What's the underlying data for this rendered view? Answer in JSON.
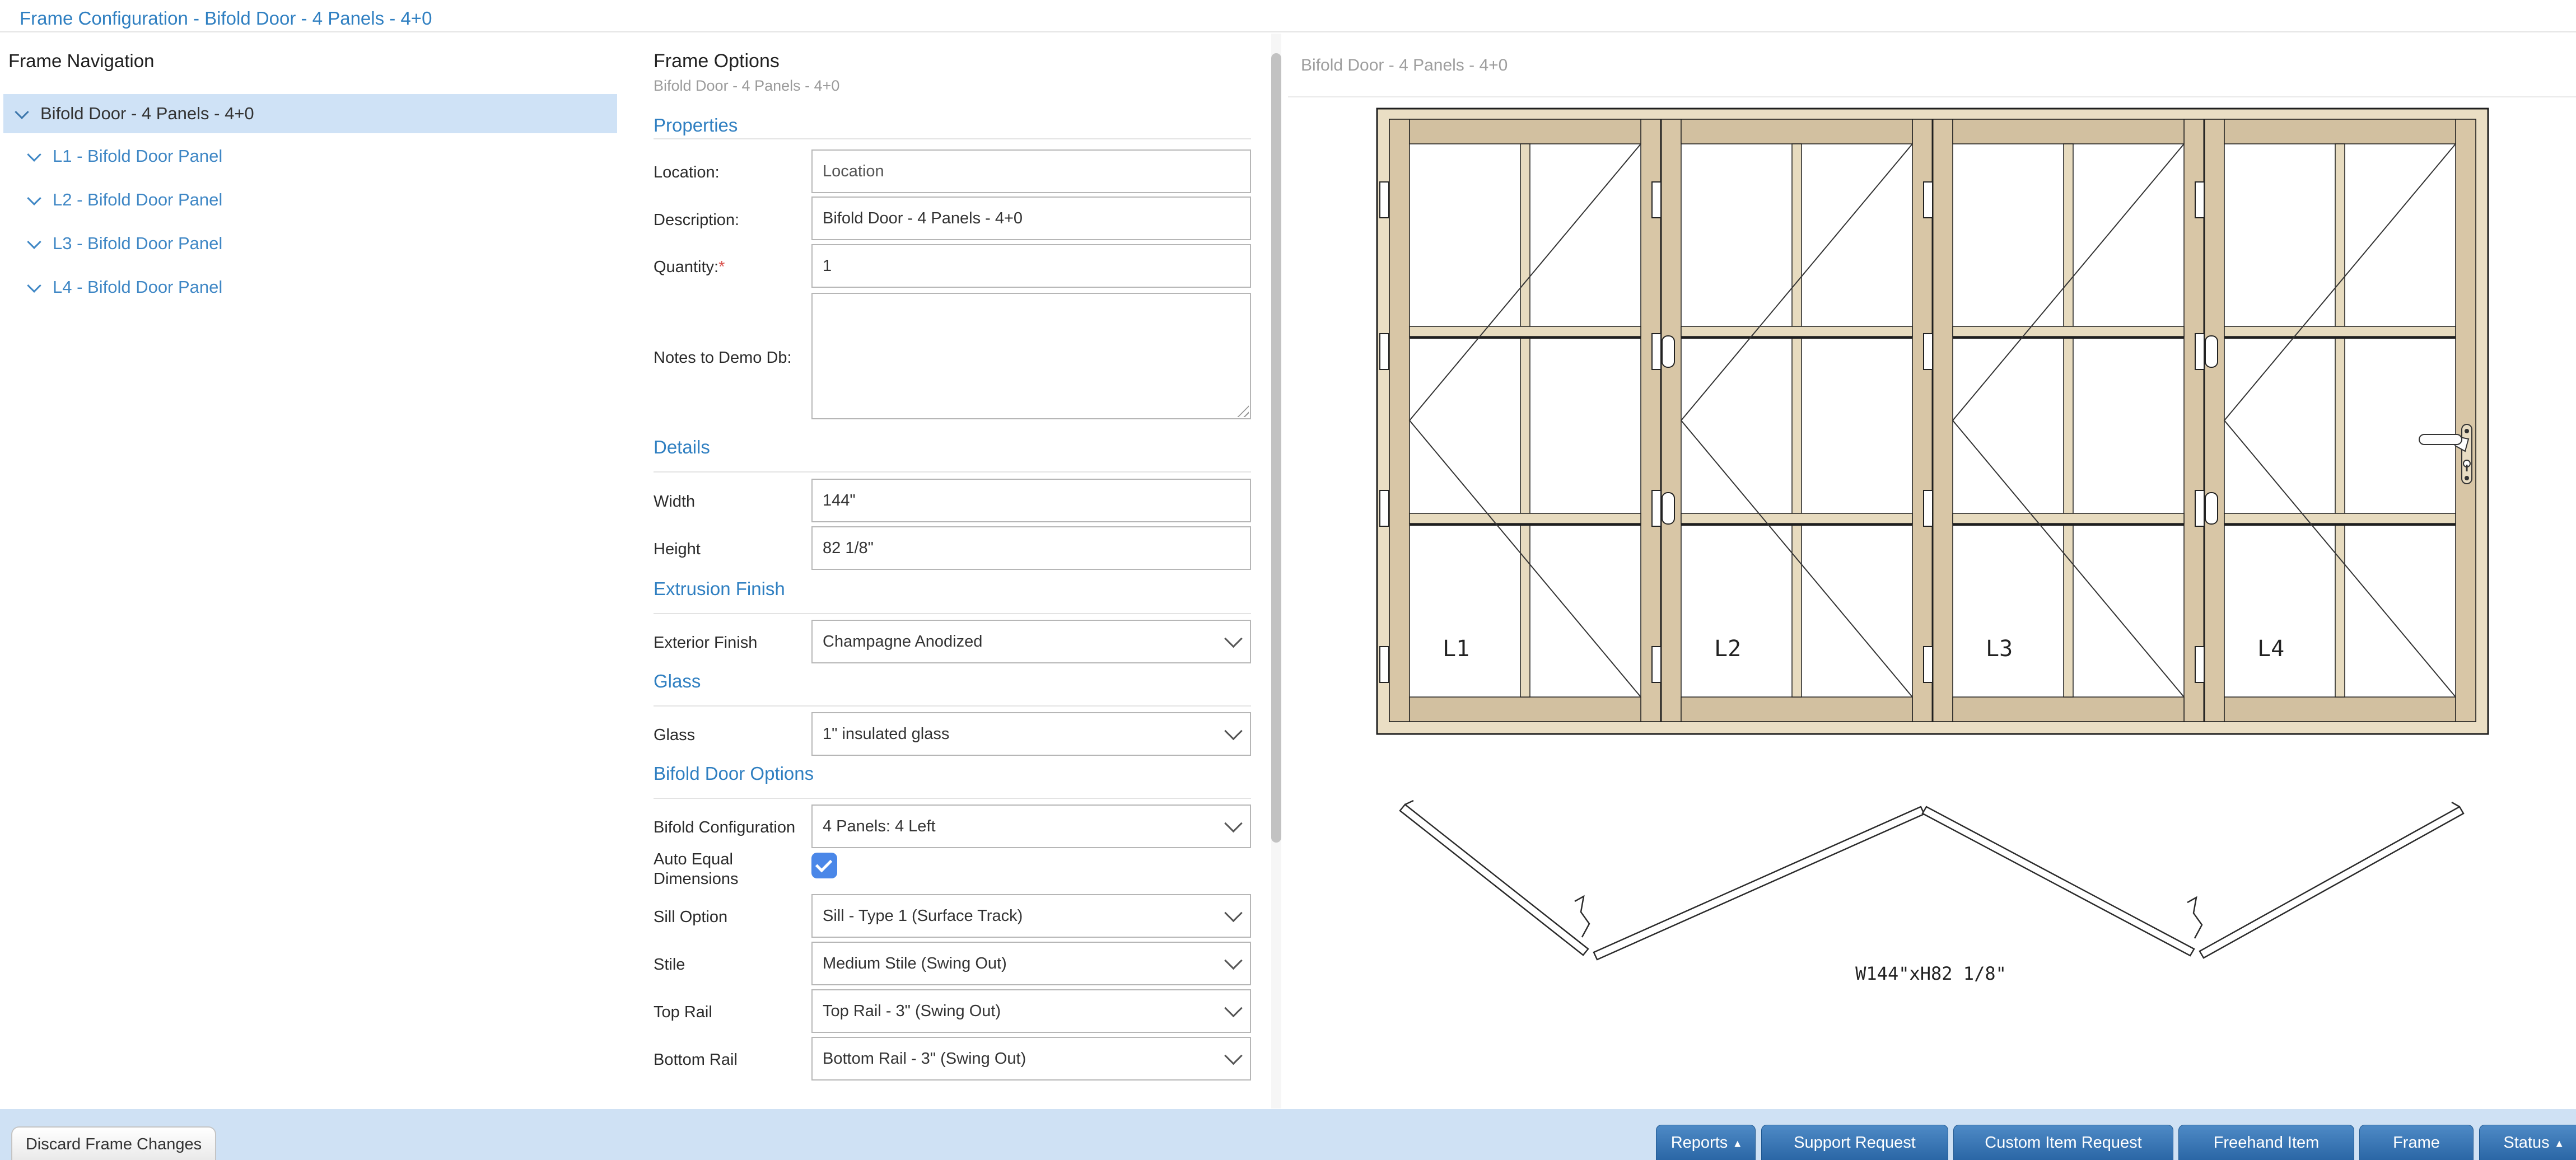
{
  "page": {
    "title": "Frame Configuration - Bifold Door - 4 Panels - 4+0"
  },
  "nav": {
    "heading": "Frame Navigation",
    "items": [
      {
        "label": "Bifold Door - 4 Panels - 4+0",
        "selected": true
      },
      {
        "label": "L1 - Bifold Door Panel"
      },
      {
        "label": "L2 - Bifold Door Panel"
      },
      {
        "label": "L3 - Bifold Door Panel"
      },
      {
        "label": "L4 - Bifold Door Panel"
      }
    ]
  },
  "form": {
    "heading": "Frame Options",
    "subtitle": "Bifold Door - 4 Panels - 4+0",
    "sections": {
      "properties": "Properties",
      "details": "Details",
      "extrusion": "Extrusion Finish",
      "glass": "Glass",
      "bifold": "Bifold Door Options"
    },
    "fields": {
      "location": {
        "label": "Location:",
        "placeholder": "Location",
        "value": ""
      },
      "description": {
        "label": "Description:",
        "value": "Bifold Door - 4 Panels - 4+0"
      },
      "quantity": {
        "label": "Quantity:",
        "required_mark": "*",
        "value": "1"
      },
      "notes": {
        "label": "Notes to Demo Db:",
        "value": ""
      },
      "width": {
        "label": "Width",
        "value": "144\""
      },
      "height": {
        "label": "Height",
        "value": "82 1/8\""
      },
      "exterior_finish": {
        "label": "Exterior Finish",
        "value": "Champagne Anodized"
      },
      "glass": {
        "label": "Glass",
        "value": "1\" insulated glass"
      },
      "bifold_configuration": {
        "label": "Bifold Configuration",
        "value": "4 Panels: 4 Left"
      },
      "auto_equal": {
        "label": "Auto Equal Dimensions",
        "checked": true
      },
      "sill_option": {
        "label": "Sill Option",
        "value": "Sill - Type 1 (Surface Track)"
      },
      "stile": {
        "label": "Stile",
        "value": "Medium Stile (Swing Out)"
      },
      "top_rail": {
        "label": "Top Rail",
        "value": "Top Rail - 3\" (Swing Out)"
      },
      "bottom_rail": {
        "label": "Bottom Rail",
        "value": "Bottom Rail - 3\" (Swing Out)"
      }
    }
  },
  "preview": {
    "title": "Bifold Door - 4 Panels - 4+0",
    "panel_labels": [
      "L1",
      "L2",
      "L3",
      "L4"
    ],
    "dimension_label": "W144\"xH82 1/8\""
  },
  "footer": {
    "discard_label": "Discard Frame Changes",
    "buttons": [
      {
        "label": "Reports",
        "caret": "▴"
      },
      {
        "label": "Support Request"
      },
      {
        "label": "Custom Item Request"
      },
      {
        "label": "Freehand Item"
      },
      {
        "label": "Frame"
      },
      {
        "label": "Status",
        "caret": "▴"
      }
    ]
  },
  "colors": {
    "link_blue": "#2f7fc1",
    "selected_row_bg": "#cfe2f6",
    "tree_item_blue": "#3f87c5",
    "footer_bg": "#cfe1f4",
    "button_blue_top": "#4e8ac6",
    "button_blue_bottom": "#2a66a5",
    "checkbox_blue": "#4a87e8",
    "required_red": "#d9534f",
    "frame_tan_light": "#eadec4",
    "frame_tan_mid": "#d8c6a6",
    "frame_tan_pale": "#e7dbbf"
  }
}
